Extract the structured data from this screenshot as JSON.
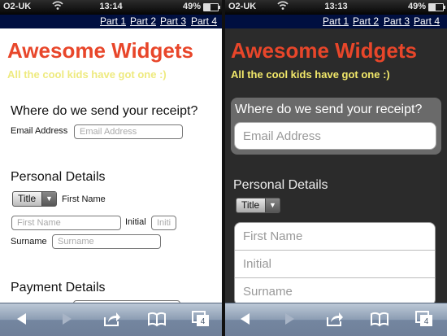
{
  "status": {
    "carrier": "O2-UK",
    "time_left": "13:14",
    "time_right": "13:13",
    "battery": "49%"
  },
  "nav": {
    "items": [
      "Part 1",
      "Part 2",
      "Part 3",
      "Part 4"
    ]
  },
  "site": {
    "title": "Awesome Widgets",
    "tagline": "All the cool kids have got one :)"
  },
  "receipt": {
    "heading": "Where do we send your receipt?",
    "email_label": "Email Address",
    "email_placeholder": "Email Address"
  },
  "personal": {
    "heading": "Personal Details",
    "title_select": "Title",
    "first_name_label": "First Name",
    "first_name_placeholder": "First Name",
    "initial_label": "Initial",
    "initial_placeholder": "Initi",
    "initial_placeholder_full": "Initial",
    "surname_label": "Surname",
    "surname_placeholder": "Surname"
  },
  "payment": {
    "heading": "Payment Details"
  },
  "toolbar": {
    "tabs_count": "4"
  },
  "colors": {
    "title": "#e8462a",
    "tagline": "#eeea7f",
    "nav_bg": "#000f40",
    "dark_bg": "#2b2b2b"
  }
}
